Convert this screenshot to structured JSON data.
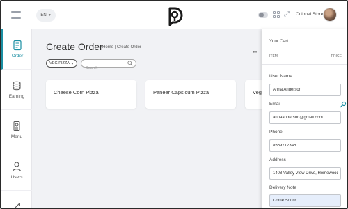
{
  "topbar": {
    "lang": "EN",
    "store_name": "Colonel Store"
  },
  "sidebar": {
    "items": [
      {
        "label": "Order",
        "icon": "order-icon"
      },
      {
        "label": "Earning",
        "icon": "coins-icon"
      },
      {
        "label": "Menu",
        "icon": "menu-book-icon"
      },
      {
        "label": "Users",
        "icon": "users-icon"
      }
    ]
  },
  "main": {
    "title": "Create Order",
    "breadcrumb": "Home  |  Create Order",
    "filter": "VEG PIZZA",
    "search_placeholder": "Search",
    "products": [
      "Cheese Corn Pizza",
      "Paneer Capsicum Pizza",
      "Veg"
    ]
  },
  "cart": {
    "title": "Your Cart",
    "col_item": "ITEM",
    "col_price": "PRICE",
    "fields": {
      "user_name_label": "User Name",
      "user_name": "Anna Anderson",
      "email_label": "Email",
      "email": "annaanderson@gmail.com",
      "phone_label": "Phone",
      "phone": "8569712345",
      "address_label": "Address",
      "address": "1408 Valley View Drive, Homewood",
      "note_label": "Delivery Note",
      "note": "Come Soon!"
    }
  },
  "colors": {
    "accent": "#1a8fa3",
    "note_bg": "#e6eefb"
  }
}
